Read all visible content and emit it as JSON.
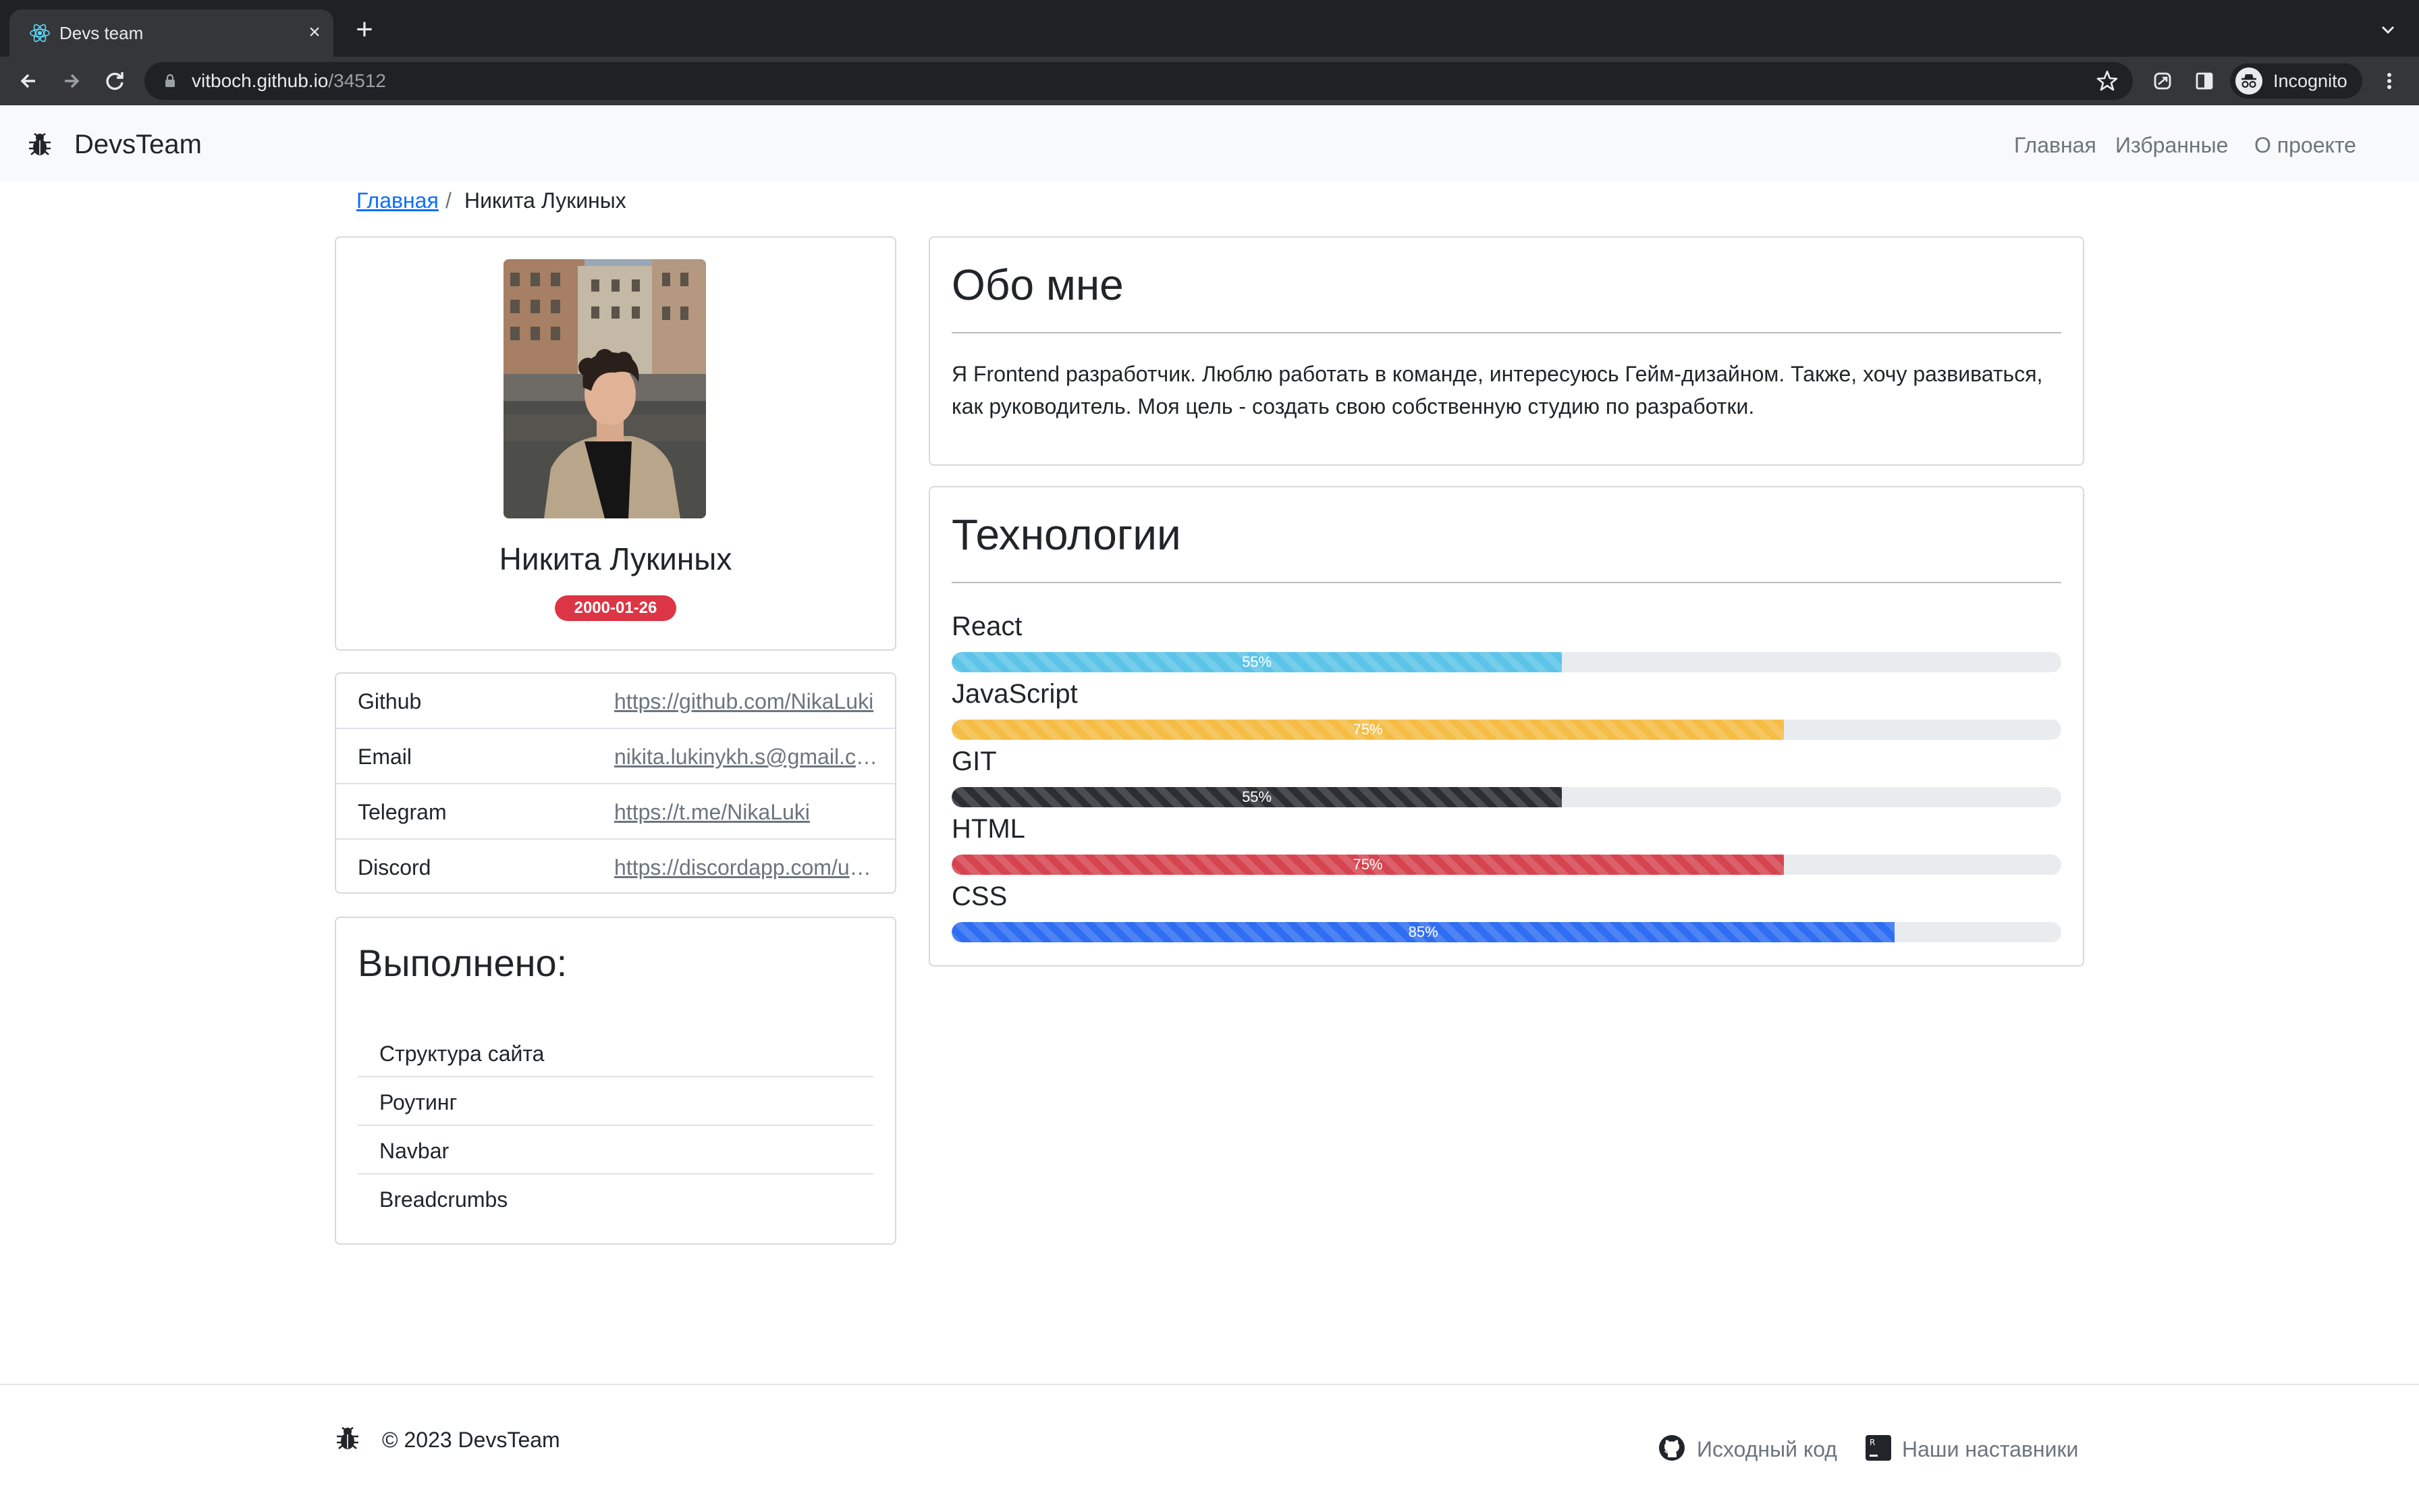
{
  "browser": {
    "tab_title": "Devs team",
    "close_glyph": "×",
    "new_tab_glyph": "+",
    "url_host": "vitboch.github.io",
    "url_path": "/34512",
    "incognito_label": "Incognito",
    "icons": [
      "react-icon",
      "back-icon",
      "forward-icon",
      "reload-icon",
      "lock-icon",
      "star-icon",
      "extensions-icon",
      "sidepanel-icon",
      "incognito-icon",
      "menu-icon"
    ]
  },
  "navbar": {
    "brand": "DevsTeam",
    "links": [
      "Главная",
      "Избранные",
      "О проекте"
    ]
  },
  "breadcrumb": {
    "home": "Главная",
    "separator": "/",
    "current": "Никита Лукиных"
  },
  "profile": {
    "name": "Никита Лукиных",
    "birthdate": "2000-01-26",
    "badge_color": "#dc3545"
  },
  "contacts": [
    {
      "label": "Github",
      "value": "https://github.com/NikaLuki"
    },
    {
      "label": "Email",
      "value": "nikita.lukinykh.s@gmail.com"
    },
    {
      "label": "Telegram",
      "value": "https://t.me/NikaLuki"
    },
    {
      "label": "Discord",
      "value": "https://discordapp.com/users"
    }
  ],
  "done": {
    "title": "Выполнено:",
    "items": [
      "Структура сайта",
      "Роутинг",
      "Navbar",
      "Breadcrumbs"
    ]
  },
  "about": {
    "title": "Обо мне",
    "text": "Я Frontend разработчик. Люблю работать в команде, интересуюсь Гейм-дизайном. Также, хочу развиваться, как руководитель. Моя цель - создать свою собственную студию по разработки."
  },
  "tech": {
    "title": "Технологии",
    "skills": [
      {
        "name": "React",
        "percent": 55,
        "label": "55%",
        "color": "#5bc4e8"
      },
      {
        "name": "JavaScript",
        "percent": 75,
        "label": "75%",
        "color": "#f5bd44"
      },
      {
        "name": "GIT",
        "percent": 55,
        "label": "55%",
        "color": "#2b2f33"
      },
      {
        "name": "HTML",
        "percent": 75,
        "label": "75%",
        "color": "#d6444f"
      },
      {
        "name": "CSS",
        "percent": 85,
        "label": "85%",
        "color": "#2f6df2"
      }
    ]
  },
  "footer": {
    "copyright": "© 2023 DevsTeam",
    "source_link": "Исходный код",
    "mentors_link": "Наши наставники"
  }
}
